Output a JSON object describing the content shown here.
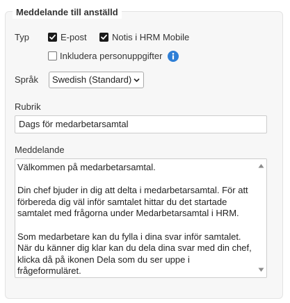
{
  "fieldset": {
    "legend": "Meddelande till anställd"
  },
  "typ": {
    "label": "Typ",
    "email_label": "E-post",
    "email_checked": true,
    "hrm_mobile_label": "Notis i HRM Mobile",
    "hrm_mobile_checked": true,
    "personal_data_label": "Inkludera personuppgifter",
    "personal_data_checked": false
  },
  "language": {
    "label": "Språk",
    "selected": "Swedish (Standard)"
  },
  "subject": {
    "label": "Rubrik",
    "value": "Dags för medarbetarsamtal"
  },
  "message": {
    "label": "Meddelande",
    "value": "Välkommen på medarbetarsamtal.\n\nDin chef bjuder in dig att delta i medarbetarsamtal. För att förbereda dig väl inför samtalet hittar du det startade samtalet med frågorna under Medarbetarsamtal i HRM.\n\nSom medarbetare kan du fylla i dina svar inför samtalet. När du känner dig klar kan du dela dina svar med din chef, klicka då på ikonen Dela som du ser uppe i frågeformuläret."
  },
  "colors": {
    "panel_bg": "#f7f7f7",
    "info_icon": "#2f7fd6"
  }
}
